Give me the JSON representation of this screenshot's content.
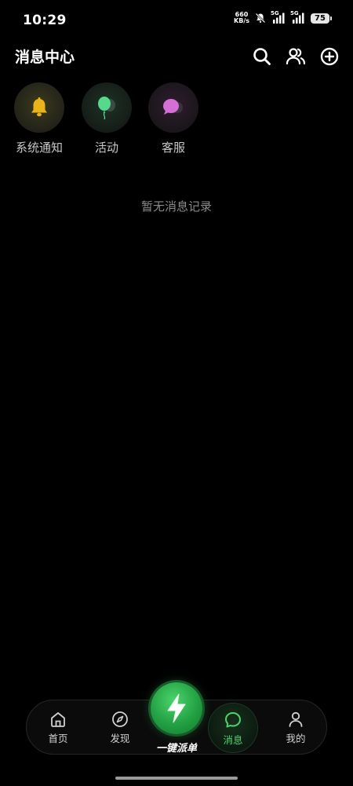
{
  "status_bar": {
    "time": "10:29",
    "net_speed_value": "660",
    "net_speed_unit": "KB/s",
    "signal1": "5G",
    "signal2": "5G",
    "battery": "75"
  },
  "header": {
    "title": "消息中心",
    "icons": [
      "search-icon",
      "contacts-icon",
      "add-circle-icon"
    ]
  },
  "categories": [
    {
      "label": "系统通知",
      "icon": "bell-icon",
      "color": "#e8b417"
    },
    {
      "label": "活动",
      "icon": "balloon-icon",
      "color": "#55d98a"
    },
    {
      "label": "客服",
      "icon": "chat-bubble-icon",
      "color": "#d46fd6"
    }
  ],
  "empty_text": "暂无消息记录",
  "bottom_nav": {
    "items": [
      {
        "label": "首页",
        "icon": "home-icon"
      },
      {
        "label": "发现",
        "icon": "compass-icon"
      },
      {
        "label": "消息",
        "icon": "message-icon",
        "active": true
      },
      {
        "label": "我的",
        "icon": "user-icon"
      }
    ],
    "center_button": {
      "label": "一键派单",
      "icon": "lightning-icon"
    },
    "active_color": "#4cd46c"
  }
}
